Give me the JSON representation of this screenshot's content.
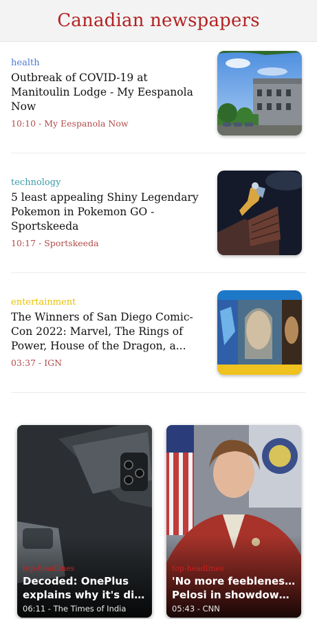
{
  "header": {
    "title": "Canadian newspapers"
  },
  "articles": [
    {
      "category": "health",
      "category_color": "#4a7bd0",
      "headline": "Outbreak of COVID-19 at Manitoulin Lodge - My Eespanola Now",
      "meta": "10:10 - My Eespanola Now",
      "image": "building-photo"
    },
    {
      "category": "technology",
      "category_color": "#3a9aa8",
      "headline": "5 least appealing Shiny Legendary Pokemon in Pokemon GO - Sportskeeda",
      "meta": "10:17 - Sportskeeda",
      "image": "pokemon-artwork"
    },
    {
      "category": "entertainment",
      "category_color": "#e8c200",
      "headline": "The Winners of San Diego Comic-Con 2022: Marvel, The Rings of Power, House of the Dragon, a...",
      "meta": "03:37 - IGN",
      "image": "comic-con-collage"
    }
  ],
  "cards": [
    {
      "category": "top-headlines",
      "headline_line1": "Decoded: OnePlus",
      "headline_line2": "explains why it's ditc...",
      "meta": "06:11 - The Times of India",
      "image": "phone-photo"
    },
    {
      "category": "top-headlines",
      "headline_line1": "'No more feebleness':",
      "headline_line2": "Pelosi in showdown ...",
      "meta": "05:43 - CNN",
      "image": "speaker-photo"
    }
  ],
  "colors": {
    "brand": "#b22222",
    "meta": "#b24a4a"
  }
}
